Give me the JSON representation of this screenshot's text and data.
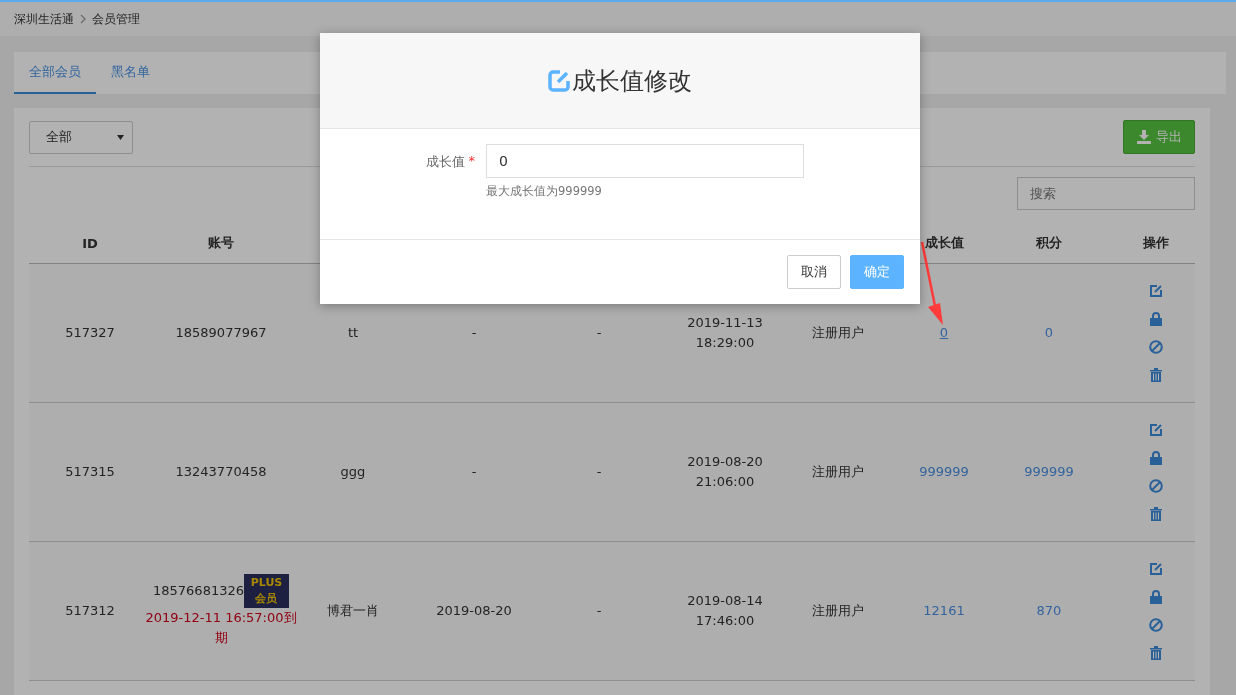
{
  "breadcrumb": [
    "深圳生活通",
    "会员管理"
  ],
  "tabs": [
    {
      "label": "全部会员",
      "selected": true
    },
    {
      "label": "黑名单",
      "selected": false
    }
  ],
  "filter": {
    "value": "全部"
  },
  "export_button": "导出",
  "search": {
    "placeholder": "搜索"
  },
  "table": {
    "columns": [
      "ID",
      "账号",
      null,
      null,
      null,
      null,
      null,
      "成长值",
      "积分",
      "操作"
    ],
    "rows": [
      {
        "id": "517327",
        "account": "18589077967",
        "nickname": "tt",
        "column_4": "-",
        "column_5": "-",
        "time": [
          "2019-11-13",
          "18:29:00"
        ],
        "type": "注册用户",
        "growth": "0",
        "growth_underlined": true,
        "points": "0"
      },
      {
        "id": "517315",
        "account": "13243770458",
        "nickname": "ggg",
        "column_4": "-",
        "column_5": "-",
        "time": [
          "2019-08-20",
          "21:06:00"
        ],
        "type": "注册用户",
        "growth": "999999",
        "growth_underlined": false,
        "points": "999999"
      },
      {
        "id": "517312",
        "account": "18576681326",
        "badge": "PLUS会员",
        "expiry": "2019-12-11 16:57:00到期",
        "nickname": "博君一肖",
        "column_4": "2019-08-20",
        "column_5": "-",
        "time": [
          "2019-08-14",
          "17:46:00"
        ],
        "type": "注册用户",
        "growth": "12161",
        "growth_underlined": false,
        "points": "870"
      }
    ]
  },
  "dialog": {
    "title": "成长值修改",
    "field_label": "成长值",
    "required_mark": "*",
    "value": "0",
    "hint": "最大成长值为999999",
    "buttons": [
      {
        "label": "取消",
        "kind": "default"
      },
      {
        "label": "确定",
        "kind": "primary"
      }
    ]
  }
}
